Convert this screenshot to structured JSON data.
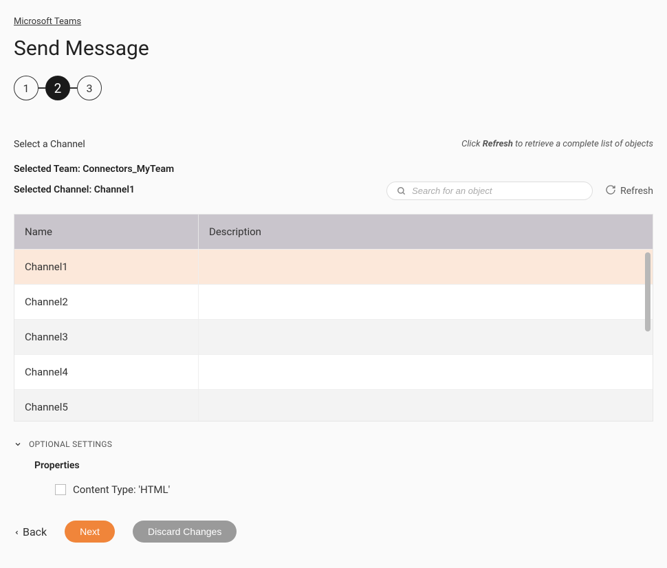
{
  "breadcrumb": "Microsoft Teams",
  "page_title": "Send Message",
  "stepper": {
    "steps": [
      "1",
      "2",
      "3"
    ],
    "active_index": 1
  },
  "section_label": "Select a Channel",
  "hint": {
    "prefix": "Click ",
    "strong": "Refresh",
    "suffix": " to retrieve a complete list of objects"
  },
  "selected_team_label": "Selected Team: Connectors_MyTeam",
  "selected_channel_label": "Selected Channel: Channel1",
  "search": {
    "placeholder": "Search for an object"
  },
  "refresh_label": "Refresh",
  "table": {
    "headers": {
      "name": "Name",
      "description": "Description"
    },
    "rows": [
      {
        "name": "Channel1",
        "description": "",
        "selected": true
      },
      {
        "name": "Channel2",
        "description": "",
        "selected": false
      },
      {
        "name": "Channel3",
        "description": "",
        "selected": false
      },
      {
        "name": "Channel4",
        "description": "",
        "selected": false
      },
      {
        "name": "Channel5",
        "description": "",
        "selected": false
      }
    ]
  },
  "optional_settings_label": "OPTIONAL SETTINGS",
  "properties_label": "Properties",
  "content_type_label": "Content Type: 'HTML'",
  "buttons": {
    "back": "Back",
    "next": "Next",
    "discard": "Discard Changes"
  }
}
